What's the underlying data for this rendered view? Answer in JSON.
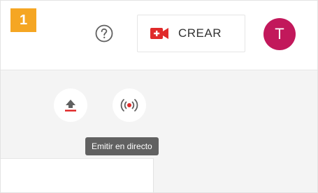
{
  "step": {
    "number": "1"
  },
  "header": {
    "help_icon": "help-circle-icon",
    "create_button": {
      "label": "CREAR",
      "icon": "video-camera-icon"
    },
    "avatar": {
      "initial": "T"
    }
  },
  "toolbar": {
    "upload_icon": "upload-icon",
    "live_icon": "live-broadcast-icon",
    "tooltip": "Emitir en directo"
  },
  "colors": {
    "step_badge": "#f5a623",
    "brand_red": "#e02b2b",
    "avatar": "#c2185b",
    "icon_gray": "#606060",
    "tooltip_bg": "#616161",
    "text_dark": "#333333"
  }
}
